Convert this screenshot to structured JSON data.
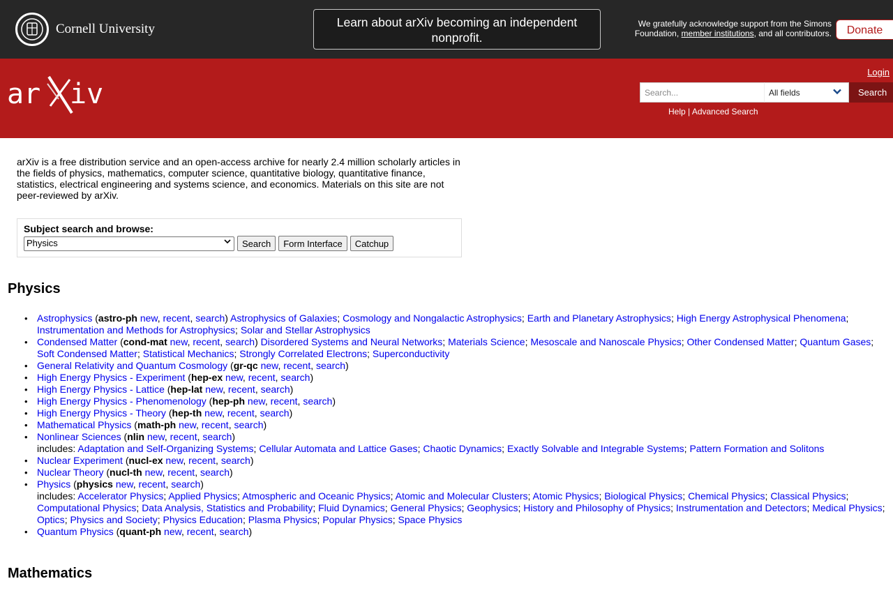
{
  "topbar": {
    "university": "Cornell University",
    "banner_text": "Learn about arXiv becoming an independent nonprofit.",
    "ack_prefix": "We gratefully acknowledge support from the Simons Foundation,",
    "ack_link": "member institutions",
    "ack_suffix": ", and all contributors.",
    "donate": "Donate"
  },
  "header": {
    "login": "Login",
    "search_placeholder": "Search...",
    "field_select": "All fields",
    "search_button": "Search",
    "help": "Help",
    "sep": " | ",
    "advanced": "Advanced Search"
  },
  "intro": "arXiv is a free distribution service and an open-access archive for nearly 2.4 million scholarly articles in the fields of physics, mathematics, computer science, quantitative biology, quantitative finance, statistics, electrical engineering and systems science, and economics. Materials on this site are not peer-reviewed by arXiv.",
  "subject_search": {
    "title": "Subject search and browse:",
    "selected": "Physics",
    "search": "Search",
    "form": "Form Interface",
    "catchup": "Catchup"
  },
  "sections": {
    "physics": "Physics",
    "mathematics": "Mathematics"
  },
  "links": {
    "new": "new",
    "recent": "recent",
    "search": "search",
    "includes": "includes:"
  },
  "archives": [
    {
      "name": "Astrophysics",
      "code": "astro-ph",
      "prefix": "",
      "subs": [
        "Astrophysics of Galaxies",
        "Cosmology and Nongalactic Astrophysics",
        "Earth and Planetary Astrophysics",
        "High Energy Astrophysical Phenomena",
        "Instrumentation and Methods for Astrophysics",
        "Solar and Stellar Astrophysics"
      ]
    },
    {
      "name": "Condensed Matter",
      "code": "cond-mat",
      "prefix": "",
      "subs": [
        "Disordered Systems and Neural Networks",
        "Materials Science",
        "Mesoscale and Nanoscale Physics",
        "Other Condensed Matter",
        "Quantum Gases",
        "Soft Condensed Matter",
        "Statistical Mechanics",
        "Strongly Correlated Electrons",
        "Superconductivity"
      ]
    },
    {
      "name": "General Relativity and Quantum Cosmology",
      "code": "gr-qc",
      "prefix": "",
      "subs": []
    },
    {
      "name": "High Energy Physics - Experiment",
      "code": "hep-ex",
      "prefix": "",
      "subs": []
    },
    {
      "name": "High Energy Physics - Lattice",
      "code": "hep-lat",
      "prefix": "",
      "subs": []
    },
    {
      "name": "High Energy Physics - Phenomenology",
      "code": "hep-ph",
      "prefix": "",
      "subs": []
    },
    {
      "name": "High Energy Physics - Theory",
      "code": "hep-th",
      "prefix": "",
      "subs": []
    },
    {
      "name": "Mathematical Physics",
      "code": "math-ph",
      "prefix": "",
      "subs": []
    },
    {
      "name": "Nonlinear Sciences",
      "code": "nlin",
      "prefix": "includes:",
      "subs": [
        "Adaptation and Self-Organizing Systems",
        "Cellular Automata and Lattice Gases",
        "Chaotic Dynamics",
        "Exactly Solvable and Integrable Systems",
        "Pattern Formation and Solitons"
      ]
    },
    {
      "name": "Nuclear Experiment",
      "code": "nucl-ex",
      "prefix": "",
      "subs": []
    },
    {
      "name": "Nuclear Theory",
      "code": "nucl-th",
      "prefix": "",
      "subs": []
    },
    {
      "name": "Physics",
      "code": "physics",
      "prefix": "includes:",
      "subs": [
        "Accelerator Physics",
        "Applied Physics",
        "Atmospheric and Oceanic Physics",
        "Atomic and Molecular Clusters",
        "Atomic Physics",
        "Biological Physics",
        "Chemical Physics",
        "Classical Physics",
        "Computational Physics",
        "Data Analysis, Statistics and Probability",
        "Fluid Dynamics",
        "General Physics",
        "Geophysics",
        "History and Philosophy of Physics",
        "Instrumentation and Detectors",
        "Medical Physics",
        "Optics",
        "Physics and Society",
        "Physics Education",
        "Plasma Physics",
        "Popular Physics",
        "Space Physics"
      ]
    },
    {
      "name": "Quantum Physics",
      "code": "quant-ph",
      "prefix": "",
      "subs": []
    }
  ]
}
